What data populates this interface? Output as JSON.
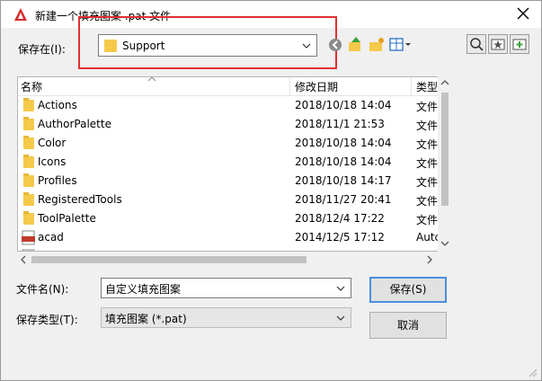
{
  "window": {
    "title": "新建一个填充图案 .pat 文件"
  },
  "save_in": {
    "label": "保存在(I):",
    "value": "Support"
  },
  "columns": {
    "name": "名称",
    "modified": "修改日期",
    "type": "类型"
  },
  "files": [
    {
      "name": "Actions",
      "modified": "2018/10/18 14:04",
      "type": "文件",
      "icon": "folder-icon"
    },
    {
      "name": "AuthorPalette",
      "modified": "2018/11/1 21:53",
      "type": "文件",
      "icon": "folder-icon"
    },
    {
      "name": "Color",
      "modified": "2018/10/18 14:04",
      "type": "文件",
      "icon": "folder-icon"
    },
    {
      "name": "Icons",
      "modified": "2018/10/18 14:04",
      "type": "文件",
      "icon": "folder-icon"
    },
    {
      "name": "Profiles",
      "modified": "2018/10/18 14:17",
      "type": "文件",
      "icon": "folder-icon"
    },
    {
      "name": "RegisteredTools",
      "modified": "2018/11/27 20:41",
      "type": "文件",
      "icon": "folder-icon"
    },
    {
      "name": "ToolPalette",
      "modified": "2018/12/4 17:22",
      "type": "文件",
      "icon": "folder-icon"
    },
    {
      "name": "acad",
      "modified": "2014/12/5 17:12",
      "type": "Autc",
      "icon": "pat-file-icon"
    }
  ],
  "file_name": {
    "label": "文件名(N):",
    "value": "自定义填充图案"
  },
  "file_type": {
    "label": "保存类型(T):",
    "value": "填充图案 (*.pat)"
  },
  "buttons": {
    "save": "保存(S)",
    "cancel": "取消"
  },
  "colors": {
    "highlight": "#e03030",
    "default_button_border": "#4a8ee0",
    "folder": "#f5c94a"
  }
}
